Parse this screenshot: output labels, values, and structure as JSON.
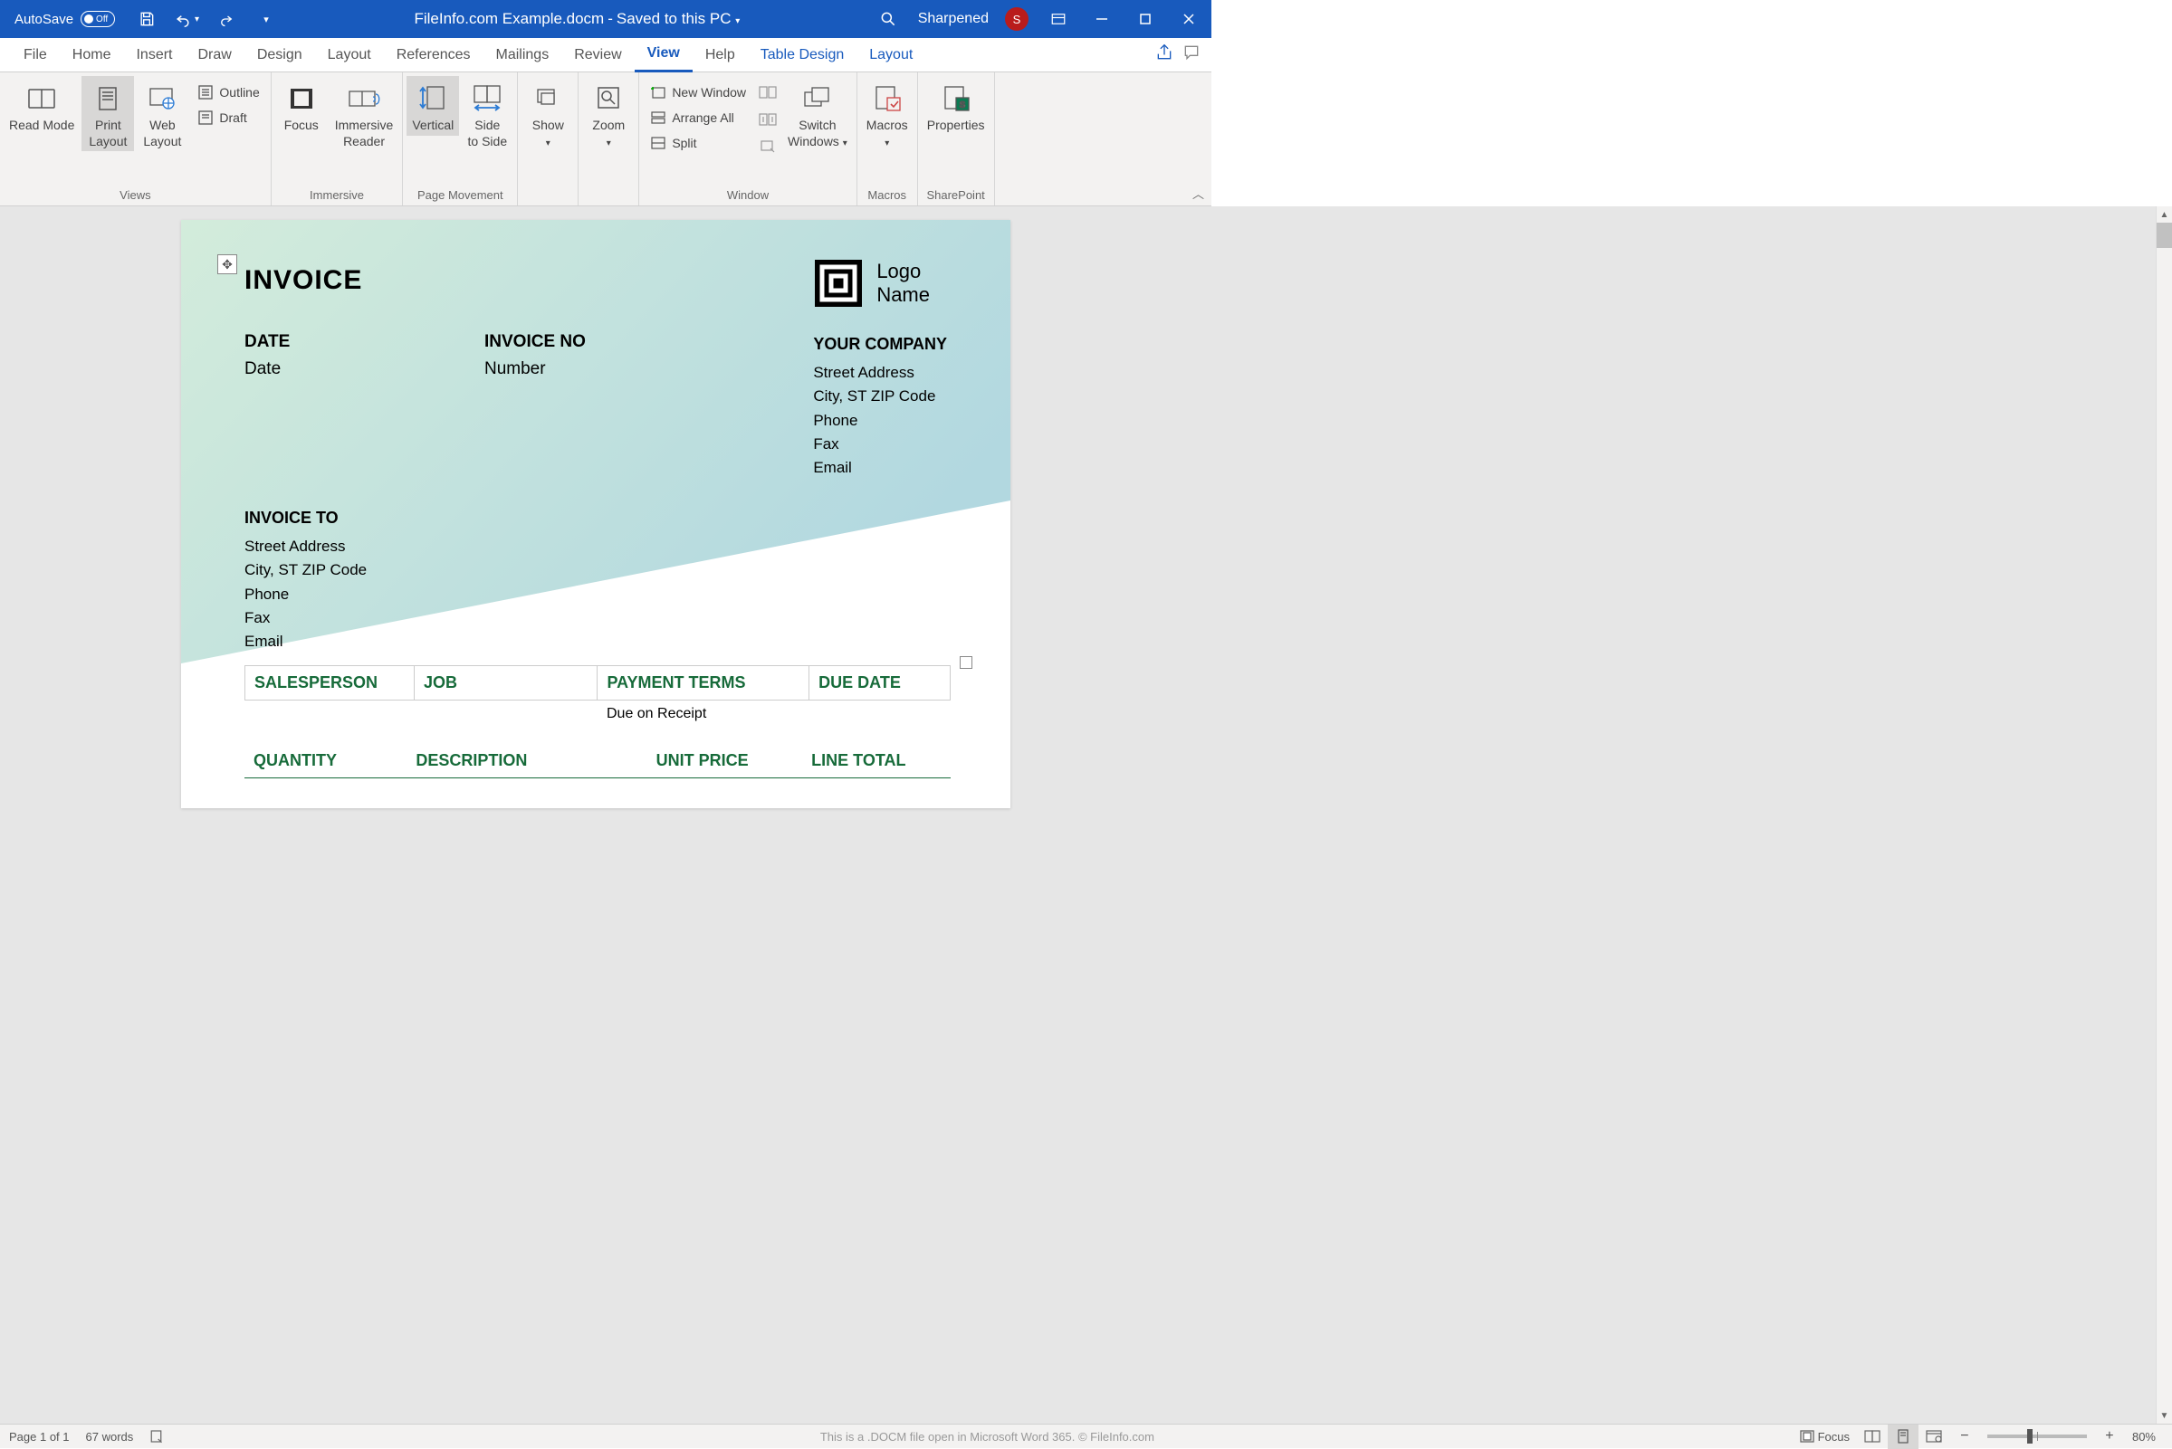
{
  "titlebar": {
    "autosave": "AutoSave",
    "autosave_state": "Off",
    "filename": "FileInfo.com Example.docm",
    "saved": "Saved to this PC",
    "user": "Sharpened",
    "avatar_initial": "S"
  },
  "tabs": [
    "File",
    "Home",
    "Insert",
    "Draw",
    "Design",
    "Layout",
    "References",
    "Mailings",
    "Review",
    "View",
    "Help",
    "Table Design",
    "Layout"
  ],
  "active_tab": "View",
  "ribbon": {
    "views": {
      "label": "Views",
      "read_mode": "Read Mode",
      "print_layout": "Print Layout",
      "web_layout": "Web Layout",
      "outline": "Outline",
      "draft": "Draft"
    },
    "immersive": {
      "label": "Immersive",
      "focus": "Focus",
      "reader": "Immersive Reader"
    },
    "page_movement": {
      "label": "Page Movement",
      "vertical": "Vertical",
      "side": "Side to Side"
    },
    "show": {
      "label": "Show"
    },
    "zoom": {
      "label": "Zoom"
    },
    "window": {
      "label": "Window",
      "new_window": "New Window",
      "arrange": "Arrange All",
      "split": "Split",
      "switch": "Switch Windows"
    },
    "macros": {
      "label": "Macros",
      "btn": "Macros"
    },
    "sharepoint": {
      "label": "SharePoint",
      "properties": "Properties"
    }
  },
  "document": {
    "title": "INVOICE",
    "date_label": "DATE",
    "date_value": "Date",
    "num_label": "INVOICE NO",
    "num_value": "Number",
    "logo_line1": "Logo",
    "logo_line2": "Name",
    "company": {
      "hd": "YOUR COMPANY",
      "l1": "Street Address",
      "l2": "City, ST ZIP Code",
      "l3": "Phone",
      "l4": "Fax",
      "l5": "Email"
    },
    "invoice_to": {
      "hd": "INVOICE TO",
      "l1": "Street Address",
      "l2": "City, ST ZIP Code",
      "l3": "Phone",
      "l4": "Fax",
      "l5": "Email"
    },
    "tbl1": {
      "h1": "SALESPERSON",
      "h2": "JOB",
      "h3": "PAYMENT TERMS",
      "h4": "DUE DATE",
      "r1": "Due on Receipt"
    },
    "tbl2": {
      "h1": "QUANTITY",
      "h2": "DESCRIPTION",
      "h3": "UNIT PRICE",
      "h4": "LINE TOTAL"
    }
  },
  "statusbar": {
    "page": "Page 1 of 1",
    "words": "67 words",
    "caption": "This is a .DOCM file open in Microsoft Word 365. © FileInfo.com",
    "focus": "Focus",
    "zoom": "80%"
  }
}
